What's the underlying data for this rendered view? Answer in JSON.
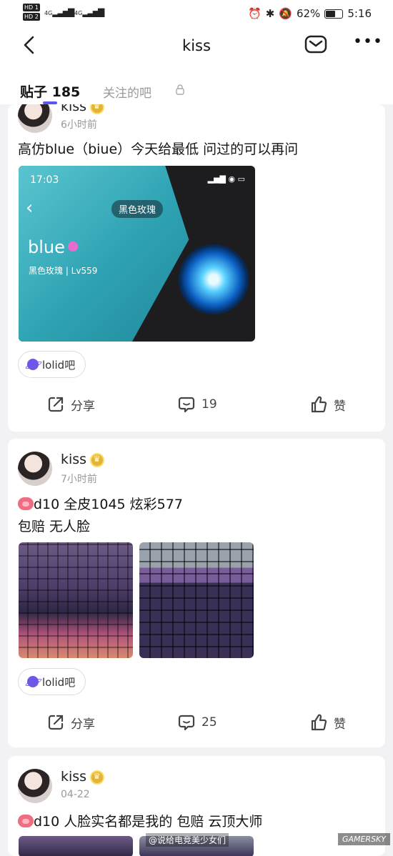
{
  "status_bar": {
    "sim1": "HD 1",
    "sim2": "HD 2",
    "signal1": "4G",
    "signal2": "4G",
    "battery": "62%",
    "battery_level": 0.62,
    "time": "5:16"
  },
  "header": {
    "title": "kiss"
  },
  "tabs": [
    {
      "label": "贴子 185",
      "active": true
    },
    {
      "label": "关注的吧",
      "active": false
    }
  ],
  "posts": [
    {
      "username": "kiss",
      "time": "6小时前",
      "text_lines": [
        "高仿blue（biue）今天给最低 问过的可以再问"
      ],
      "image": {
        "time": "17:03",
        "chip": "黑色玫瑰",
        "name": "blue",
        "sub": "黑色玫瑰 | Lv559"
      },
      "forum": "lolid吧",
      "share_label": "分享",
      "comments": "19",
      "like_label": "赞"
    },
    {
      "username": "kiss",
      "time": "7小时前",
      "text_lines": [
        "d10  全皮1045 炫彩577",
        "包赔 无人脸"
      ],
      "forum": "lolid吧",
      "share_label": "分享",
      "comments": "25",
      "like_label": "赞"
    },
    {
      "username": "kiss",
      "time": "04-22",
      "text_lines": [
        "d10  人脸实名都是我的 包赔 云顶大师"
      ]
    }
  ],
  "watermarks": {
    "weibo": "@说给电竞美少女们",
    "site": "GAMERSKY"
  }
}
